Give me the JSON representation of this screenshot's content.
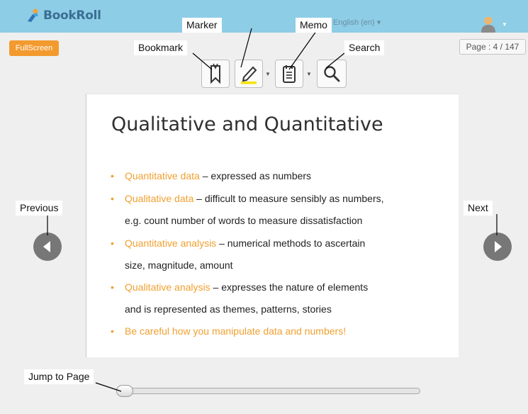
{
  "header": {
    "app_name": "BookRoll",
    "language_selector": "English (en)",
    "avatar_icon": "user-avatar-icon",
    "colors": {
      "topbar": "#8ecde6",
      "accent": "#f39a2e"
    }
  },
  "controls": {
    "fullscreen_label": "FullScreen",
    "page_indicator": "Page : 4 / 147"
  },
  "toolbar": {
    "tools": [
      {
        "name": "bookmark",
        "icon": "bookmark-icon"
      },
      {
        "name": "marker",
        "icon": "marker-icon",
        "has_dropdown": true
      },
      {
        "name": "memo",
        "icon": "memo-icon",
        "has_dropdown": true
      },
      {
        "name": "search",
        "icon": "search-icon"
      }
    ]
  },
  "slide": {
    "title": "Qualitative and Quantitative",
    "bullets": [
      {
        "highlight": "Quantitative data",
        "rest": " – expressed as numbers"
      },
      {
        "highlight": "Qualitative data",
        "rest": " – difficult to measure sensibly as numbers,",
        "cont": "e.g. count number of words to measure dissatisfaction"
      },
      {
        "highlight": "Quantitative analysis",
        "rest": " – numerical methods to ascertain",
        "cont": "size, magnitude, amount"
      },
      {
        "highlight": "Qualitative analysis",
        "rest": " – expresses the nature of elements",
        "cont": "and is represented as themes, patterns, stories"
      },
      {
        "highlight": "Be careful how you manipulate data and numbers!",
        "rest": ""
      }
    ]
  },
  "navigation": {
    "previous_icon": "previous-arrow-icon",
    "next_icon": "next-arrow-icon"
  },
  "slider": {
    "current_page": 4,
    "total_pages": 147
  },
  "annotations": {
    "marker": "Marker",
    "memo": "Memo",
    "bookmark": "Bookmark",
    "search": "Search",
    "previous": "Previous",
    "next": "Next",
    "jump_to_page": "Jump to Page"
  }
}
